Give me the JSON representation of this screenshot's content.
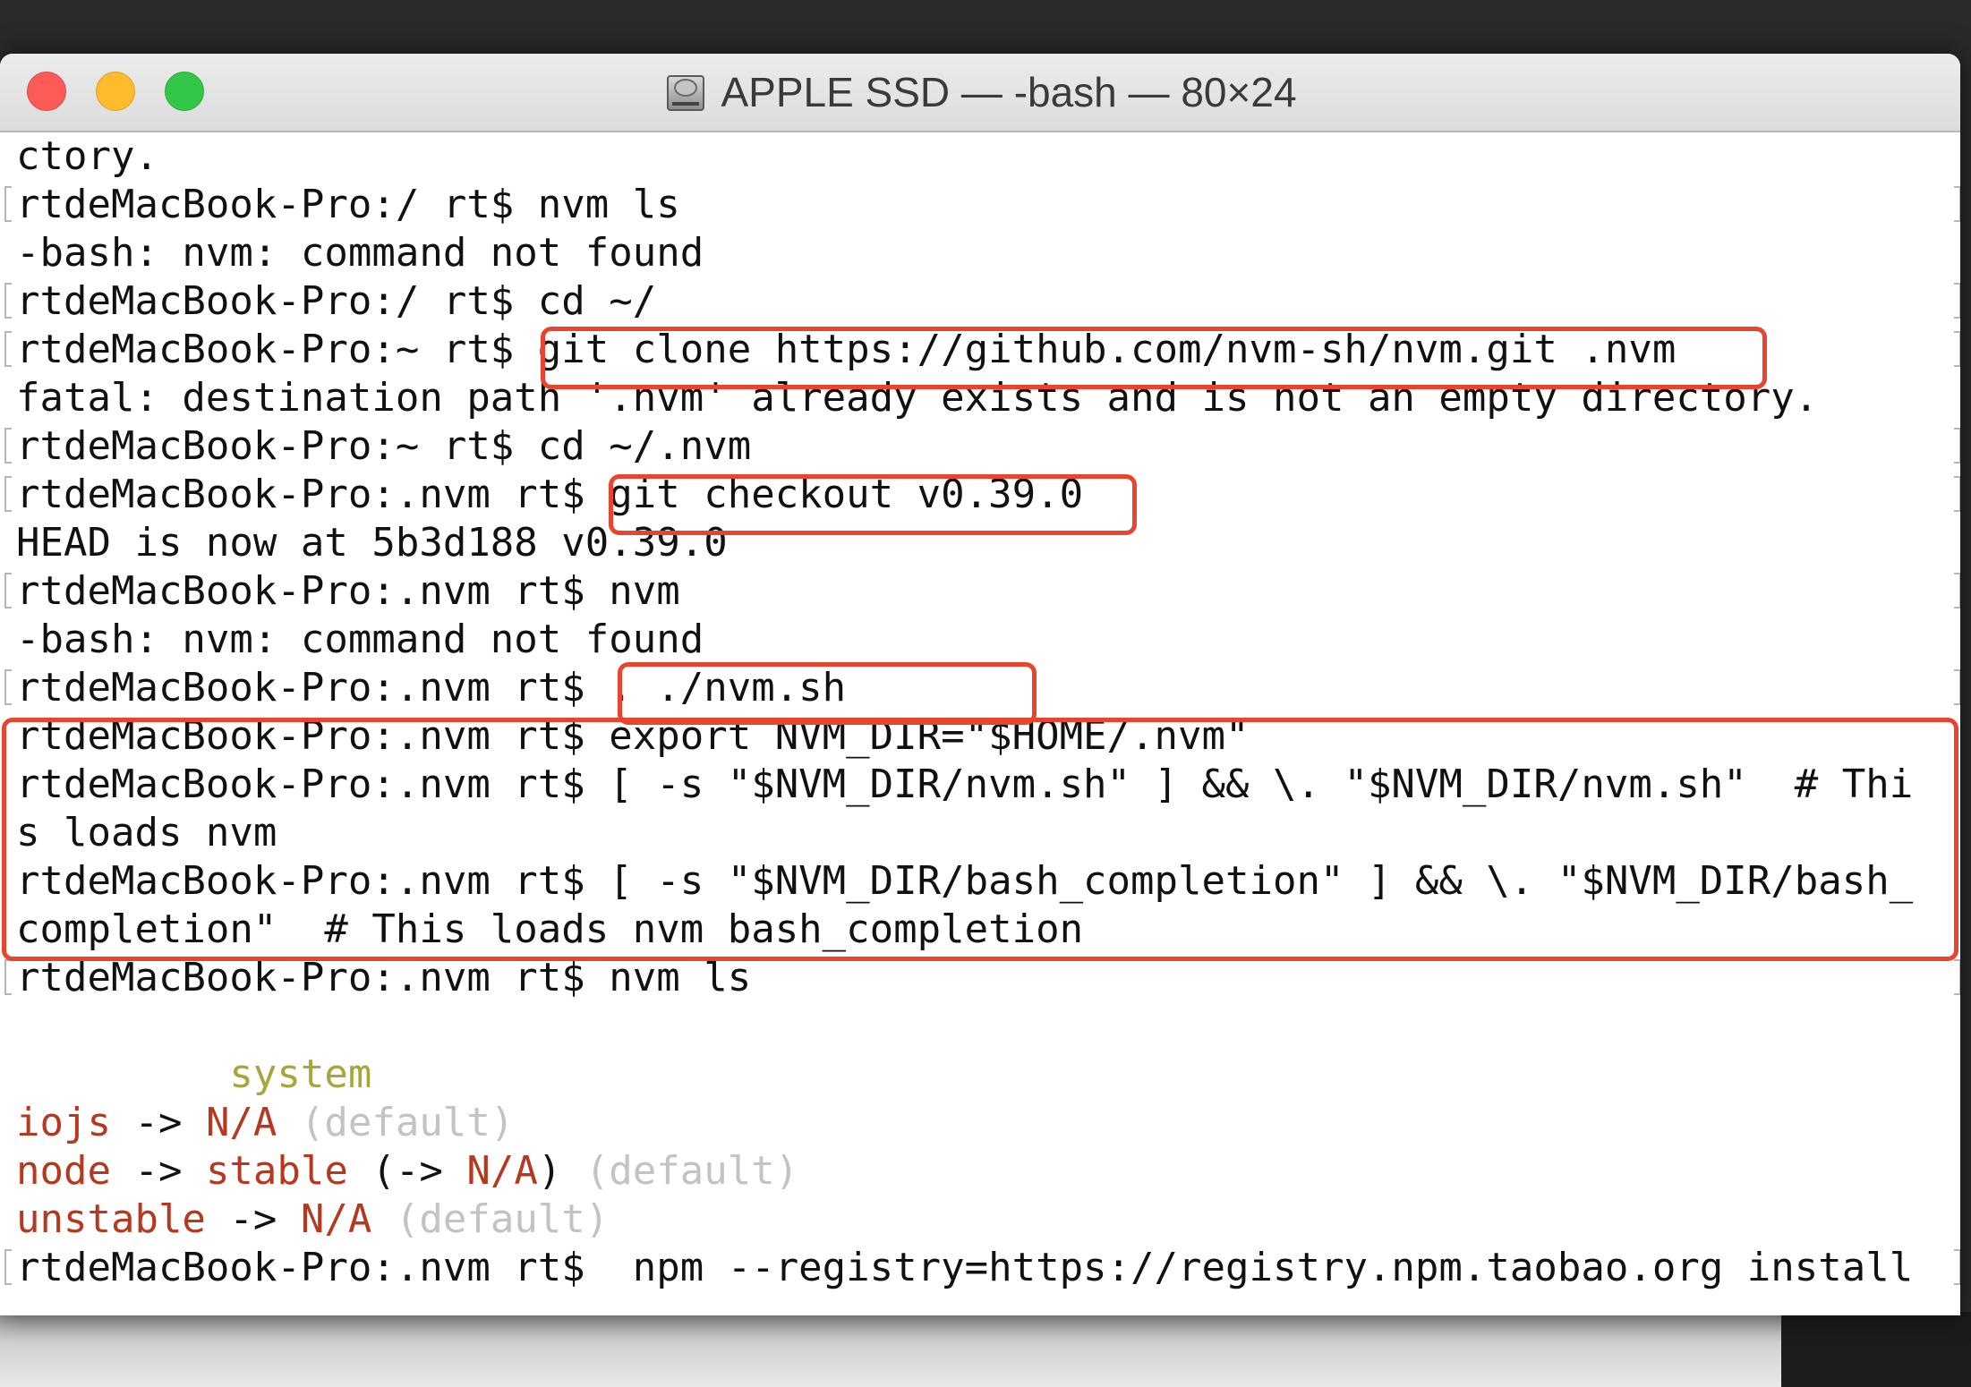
{
  "window": {
    "title": "APPLE SSD — -bash — 80×24",
    "icon": "drive-icon"
  },
  "colors": {
    "highlight": "#e8442f",
    "system": "#a7a63a",
    "alias_red": "#b5391f",
    "dim_gray": "#c3c3c3"
  },
  "terminal": {
    "l0": "ctory.",
    "l1": "rtdeMacBook-Pro:/ rt$ nvm ls",
    "l2": "-bash: nvm: command not found",
    "l3": "rtdeMacBook-Pro:/ rt$ cd ~/",
    "l4": "rtdeMacBook-Pro:~ rt$ git clone https://github.com/nvm-sh/nvm.git .nvm",
    "l5": "fatal: destination path '.nvm' already exists and is not an empty directory.",
    "l6": "rtdeMacBook-Pro:~ rt$ cd ~/.nvm",
    "l7": "rtdeMacBook-Pro:.nvm rt$ git checkout v0.39.0",
    "l8": "HEAD is now at 5b3d188 v0.39.0",
    "l9": "rtdeMacBook-Pro:.nvm rt$ nvm",
    "l10": "-bash: nvm: command not found",
    "l11": "rtdeMacBook-Pro:.nvm rt$ . ./nvm.sh",
    "l12": "rtdeMacBook-Pro:.nvm rt$ export NVM_DIR=\"$HOME/.nvm\"",
    "l13": "rtdeMacBook-Pro:.nvm rt$ [ -s \"$NVM_DIR/nvm.sh\" ] && \\. \"$NVM_DIR/nvm.sh\"  # Thi",
    "l14": "s loads nvm",
    "l15": "rtdeMacBook-Pro:.nvm rt$ [ -s \"$NVM_DIR/bash_completion\" ] && \\. \"$NVM_DIR/bash_",
    "l16": "completion\"  # This loads nvm bash_completion",
    "l17": "rtdeMacBook-Pro:.nvm rt$ nvm ls",
    "l19_indent": "         ",
    "l19_system": "system",
    "l20_a": "iojs",
    "l20_b": " -> ",
    "l20_c": "N/A",
    "l20_d": " (default)",
    "l21_a": "node",
    "l21_b": " -> ",
    "l21_c": "stable",
    "l21_d": " (-> ",
    "l21_e": "N/A",
    "l21_f": ")",
    "l21_g": " (default)",
    "l22_a": "unstable",
    "l22_b": " -> ",
    "l22_c": "N/A",
    "l22_d": " (default)",
    "l23": "rtdeMacBook-Pro:.nvm rt$  npm --registry=https://registry.npm.taobao.org install"
  }
}
